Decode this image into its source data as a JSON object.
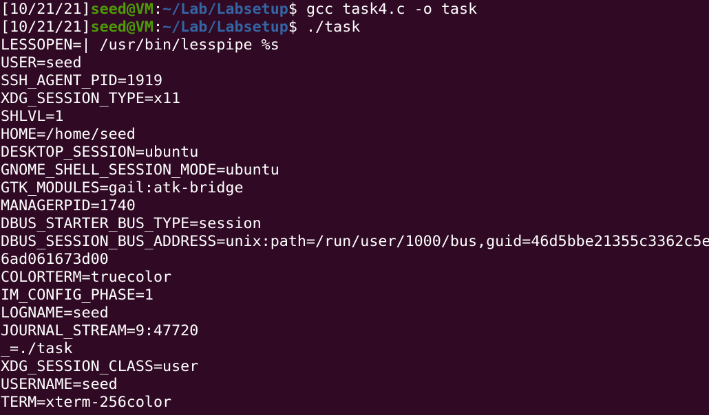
{
  "colors": {
    "background": "#300a24",
    "foreground": "#ffffff",
    "user_host": "#4e9a06",
    "path": "#3465a4"
  },
  "prompts": [
    {
      "timestamp": "[10/21/21]",
      "user_host": "seed@VM",
      "separator": ":",
      "path": "~/Lab/Labsetup",
      "symbol": "$",
      "command": " gcc task4.c -o task"
    },
    {
      "timestamp": "[10/21/21]",
      "user_host": "seed@VM",
      "separator": ":",
      "path": "~/Lab/Labsetup",
      "symbol": "$",
      "command": " ./task"
    }
  ],
  "output_lines": [
    "LESSOPEN=| /usr/bin/lesspipe %s",
    "USER=seed",
    "SSH_AGENT_PID=1919",
    "XDG_SESSION_TYPE=x11",
    "SHLVL=1",
    "HOME=/home/seed",
    "DESKTOP_SESSION=ubuntu",
    "GNOME_SHELL_SESSION_MODE=ubuntu",
    "GTK_MODULES=gail:atk-bridge",
    "MANAGERPID=1740",
    "DBUS_STARTER_BUS_TYPE=session",
    "DBUS_SESSION_BUS_ADDRESS=unix:path=/run/user/1000/bus,guid=46d5bbe21355c3362c5e",
    "6ad061673d00",
    "COLORTERM=truecolor",
    "IM_CONFIG_PHASE=1",
    "LOGNAME=seed",
    "JOURNAL_STREAM=9:47720",
    "_=./task",
    "XDG_SESSION_CLASS=user",
    "USERNAME=seed",
    "TERM=xterm-256color"
  ]
}
